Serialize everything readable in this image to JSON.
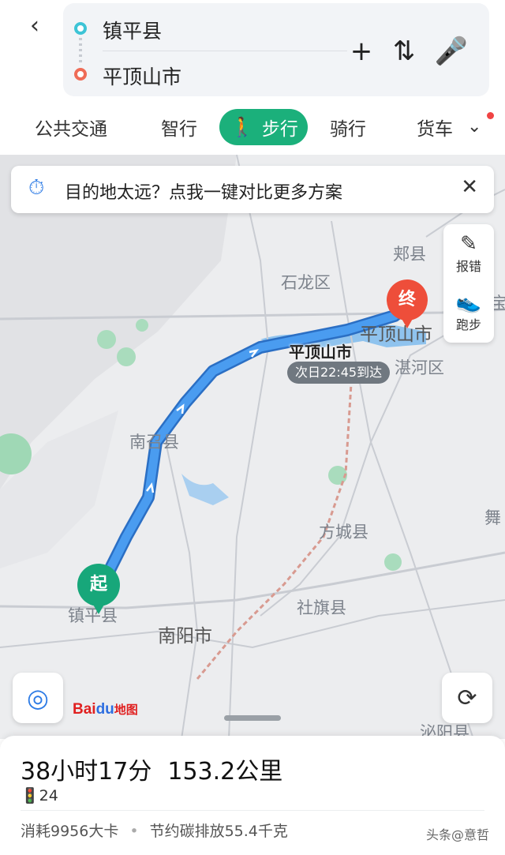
{
  "route": {
    "from": "镇平县",
    "to": "平顶山市",
    "back_icon": "‹",
    "add_icon": "+",
    "swap_icon": "⇅",
    "mic_icon": "🎤"
  },
  "tabs": [
    {
      "label": "公共交通"
    },
    {
      "label": "智行"
    },
    {
      "label": "步行",
      "active": true
    },
    {
      "label": "骑行"
    },
    {
      "label": "货车"
    }
  ],
  "tabs_more_icon": "⌄",
  "notice": {
    "icon": "⏱",
    "text": "目的地太远？点我一键对比更多方案",
    "close_icon": "✕"
  },
  "side_tools": [
    {
      "icon": "✎",
      "label": "报错"
    },
    {
      "icon": "👟",
      "label": "跑步"
    }
  ],
  "map": {
    "places": [
      {
        "name": "郏县"
      },
      {
        "name": "石龙区"
      },
      {
        "name": "平顶山市"
      },
      {
        "name": "湛河区"
      },
      {
        "name": "南召县"
      },
      {
        "name": "方城县"
      },
      {
        "name": "社旗县"
      },
      {
        "name": "南阳市"
      },
      {
        "name": "镇平县"
      },
      {
        "name": "泌阳县"
      },
      {
        "name": "舞"
      },
      {
        "name": "宝"
      }
    ],
    "destination_label": "平顶山市",
    "arrival": "次日22:45到达",
    "start_pin": "起",
    "end_pin": "终",
    "logo": {
      "prefix": "Bai",
      "paw": "du",
      "suffix": "地图"
    },
    "locate_icon": "◎",
    "refresh_icon": "⟳"
  },
  "summary": {
    "duration": "38小时17分",
    "distance": "153.2公里",
    "traffic_lights": "🚦24",
    "calories": "消耗9956大卡",
    "carbon": "节约碳排放55.4千克",
    "separator": "•"
  },
  "watermark": "头条@意哲",
  "colors": {
    "accent_green": "#1bb07b",
    "route_blue": "#3a8ee6",
    "end_red": "#ee4e3a"
  }
}
